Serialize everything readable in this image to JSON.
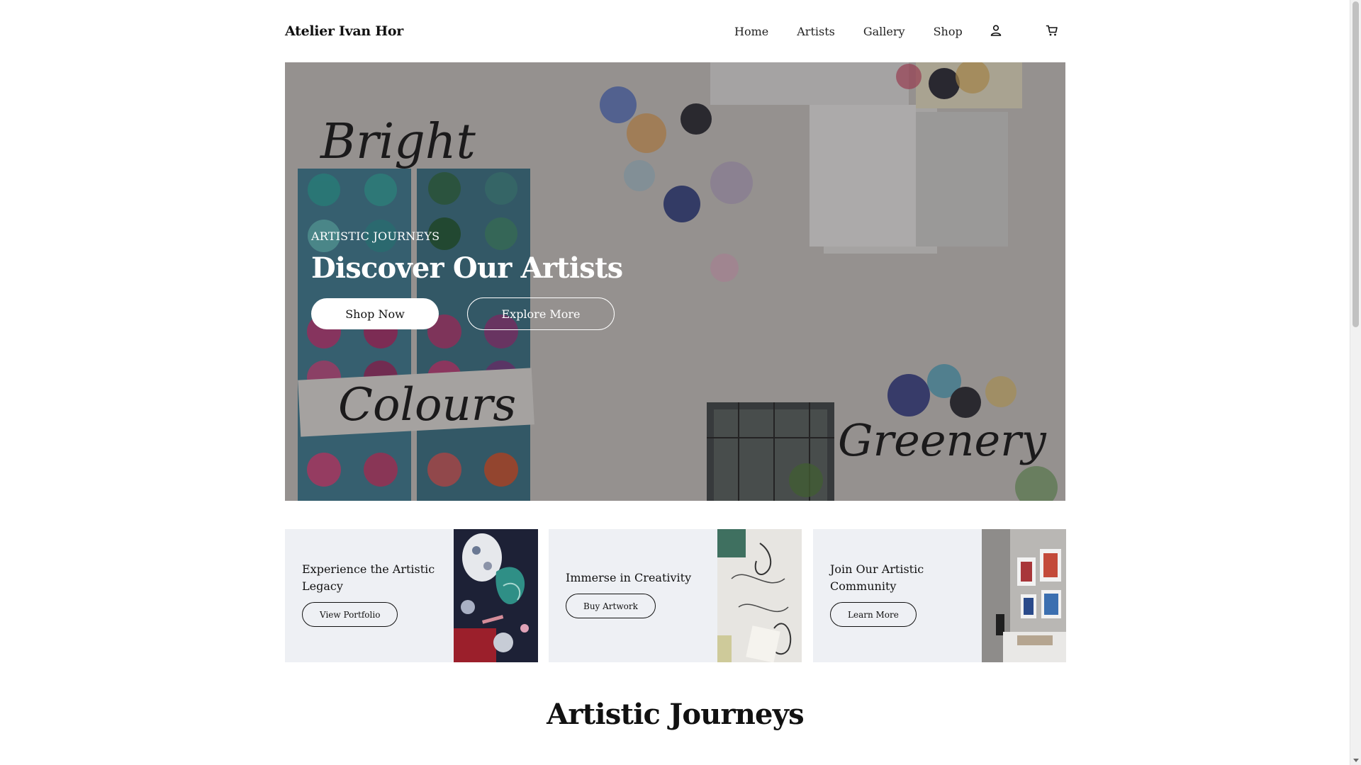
{
  "header": {
    "brand": "Atelier Ivan Hor",
    "nav": [
      "Home",
      "Artists",
      "Gallery",
      "Shop"
    ],
    "account_icon": "user-icon",
    "cart_icon": "cart-icon"
  },
  "hero": {
    "kicker": "ARTISTIC JOURNEYS",
    "title": "Discover Our Artists",
    "primary_button": "Shop Now",
    "secondary_button": "Explore More",
    "image_words": [
      "Bright",
      "Colours",
      "Greenery"
    ]
  },
  "cards": [
    {
      "title": "Experience the Artistic Legacy",
      "button": "View Portfolio"
    },
    {
      "title": "Immerse in Creativity",
      "button": "Buy Artwork"
    },
    {
      "title": "Join Our Artistic Community",
      "button": "Learn More"
    }
  ],
  "section": {
    "title": "Artistic Journeys"
  },
  "colors": {
    "card_background": "#eef0f4",
    "text": "#111111",
    "hero_overlay": "#282628"
  }
}
